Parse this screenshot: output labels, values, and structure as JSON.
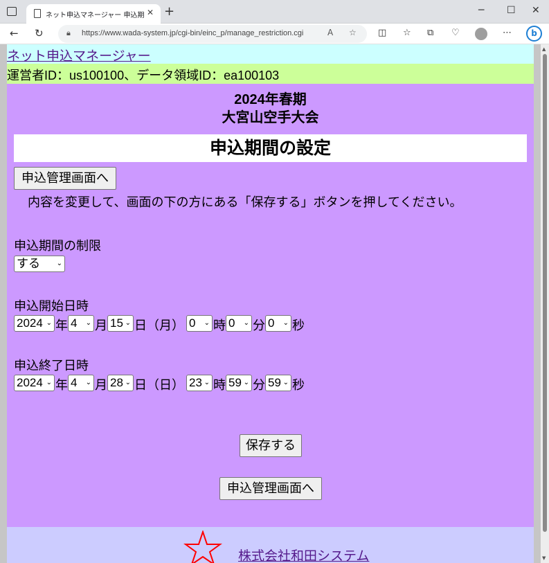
{
  "browser": {
    "tab_title": "ネット申込マネージャー 申込期間の設",
    "url": "https://www.wada-system.jp/cgi-bin/einc_p/manage_restriction.cgi",
    "new_tab_glyph": "+",
    "close_glyph": "✕"
  },
  "page": {
    "site_link": "ネット申込マネージャー",
    "ids_line": "運営者ID：us100100、データ領域ID：ea100103",
    "event_line1": "2024年春期",
    "event_line2": "大宮山空手大会",
    "heading": "申込期間の設定",
    "top_button": "申込管理画面へ",
    "instruction": "内容を変更して、画面の下の方にある「保存する」ボタンを押してください。",
    "limit_label": "申込期間の制限",
    "limit_value": "する",
    "start_label": "申込開始日時",
    "end_label": "申込終了日時",
    "save_button": "保存する",
    "bottom_button": "申込管理画面へ",
    "footer_link": "株式会社和田システム"
  },
  "start": {
    "year": "2024",
    "month": "4",
    "day": "15",
    "weekday": "日（月）",
    "hour": "0",
    "minute": "0",
    "second": "0"
  },
  "end": {
    "year": "2024",
    "month": "4",
    "day": "28",
    "weekday": "日（日）",
    "hour": "23",
    "minute": "59",
    "second": "59"
  },
  "units": {
    "year": "年",
    "month": "月",
    "hour": "時",
    "minute": "分",
    "second": "秒"
  },
  "colors": {
    "site_bar": "#ccffff",
    "id_bar": "#ccff99",
    "main_bg": "#cc99ff",
    "footer_bg": "#ccccff",
    "link": "#551a8b",
    "star": "#ff0000"
  }
}
